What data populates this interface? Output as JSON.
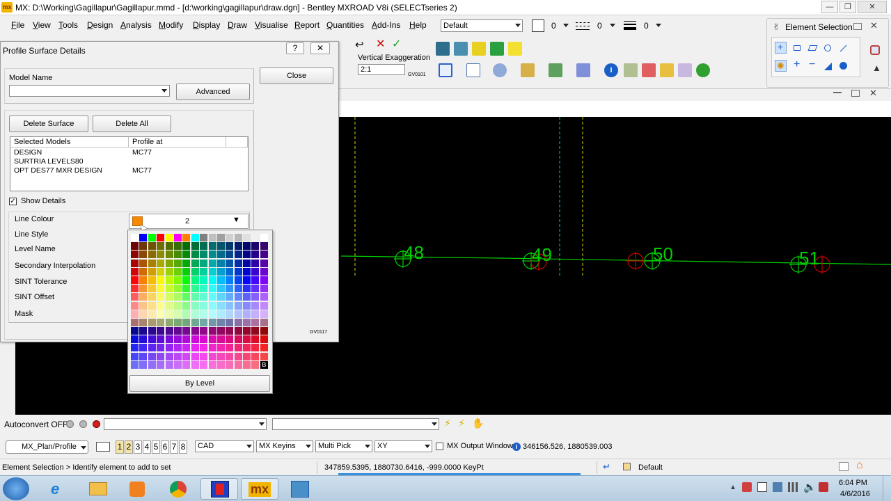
{
  "window": {
    "title": "MX: D:\\Working\\Gagillapur\\Gagillapur.mmd - [d:\\working\\gagillapur\\draw.dgn] - Bentley MXROAD V8i (SELECTseries 2)",
    "app_icon_text": "mx"
  },
  "menu": [
    "File",
    "View",
    "Tools",
    "Design",
    "Analysis",
    "Modify",
    "Display",
    "Draw",
    "Visualise",
    "Report",
    "Quantities",
    "Add-Ins",
    "Help"
  ],
  "attributes": {
    "level": "Default",
    "color_value": "0",
    "style_value": "0",
    "weight_value": "0"
  },
  "element_selection": {
    "title": "Element Selection"
  },
  "vertical_exaggeration": {
    "label": "Vertical Exaggeration",
    "value": "2:1",
    "code": "GV0101"
  },
  "dialog": {
    "title": "Profile Surface Details",
    "help_button": "?",
    "model_name_label": "Model Name",
    "model_name_value": "",
    "advanced_button": "Advanced",
    "close_button": "Close",
    "delete_surface_button": "Delete Surface",
    "delete_all_button": "Delete All",
    "columns": [
      "Selected Models",
      "Profile at"
    ],
    "rows": [
      {
        "model": "DESIGN",
        "profile_at": "MC77"
      },
      {
        "model": "SURTRIA LEVELS80",
        "profile_at": ""
      },
      {
        "model": "OPT DES77 MXR DESIGN",
        "profile_at": "MC77"
      }
    ],
    "show_details_label": "Show Details",
    "show_details_checked": true,
    "detail_labels": [
      "Line Colour",
      "Line Style",
      "Level Name",
      "Secondary Interpolation",
      "SINT Tolerance",
      "SINT Offset",
      "Mask"
    ],
    "line_colour_value": "2",
    "line_colour_hex": "#f58a00",
    "footer_code": "GV0117"
  },
  "palette": {
    "by_level_label": "By Level",
    "bg_marker": "B"
  },
  "canvas": {
    "chainage_labels": [
      "48",
      "49",
      "50",
      "51"
    ],
    "profile_color": "#00d000",
    "marker_red": "#d00000"
  },
  "autoconvert": {
    "label": "Autoconvert OFF"
  },
  "bottom_toolbar": {
    "model_select": "MX_Plan/Profile",
    "view_numbers": [
      "1",
      "2",
      "3",
      "4",
      "5",
      "6",
      "7",
      "8"
    ],
    "cad_select": "CAD",
    "keyins_select": "MX Keyins",
    "pick_select": "Multi Pick",
    "xy_select": "XY",
    "output_window_label": "MX Output Window",
    "coordinates": "346156.526, 1880539.003"
  },
  "status": {
    "prompt": "Element Selection > Identify element to add to set",
    "pointer": "347859.5395, 1880730.6416, -999.0000 KeyPt",
    "level": "Default"
  },
  "taskbar": {
    "clock_time": "6:04 PM",
    "clock_date": "4/6/2016",
    "apps": [
      "windows-start",
      "internet-explorer",
      "file-explorer",
      "media-player",
      "chrome",
      "mx-app-red",
      "mxroad",
      "mx-network"
    ]
  }
}
